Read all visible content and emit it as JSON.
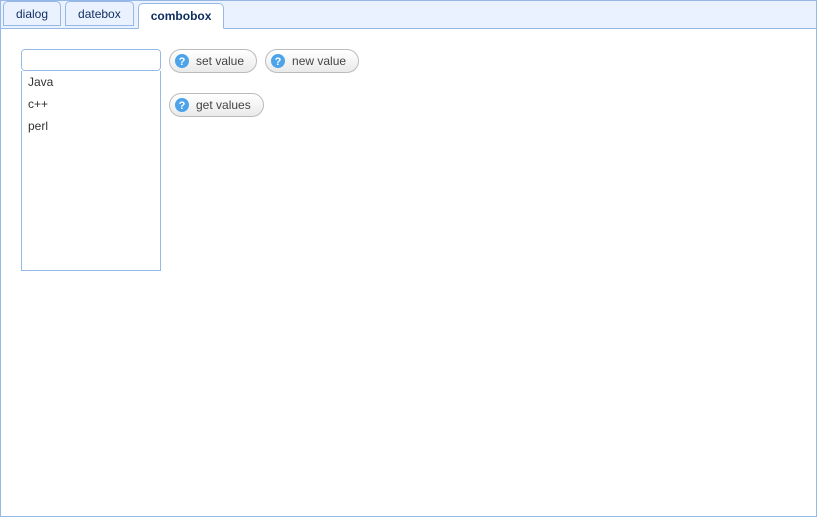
{
  "tabs": [
    {
      "label": "dialog",
      "active": false
    },
    {
      "label": "datebox",
      "active": false
    },
    {
      "label": "combobox",
      "active": true
    }
  ],
  "combo": {
    "value": "",
    "options": [
      "Java",
      "c++",
      "perl"
    ]
  },
  "buttons": {
    "set_value": "set value",
    "new_value": "new value",
    "get_values": "get values"
  }
}
